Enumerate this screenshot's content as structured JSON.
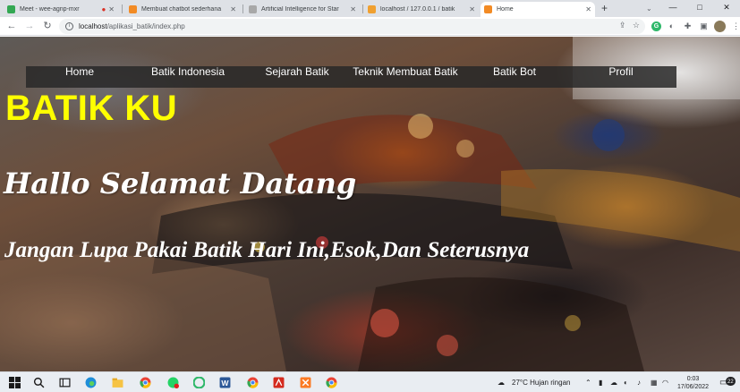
{
  "browser": {
    "tabs": [
      {
        "title": "Meet - wee-agnp-mxr",
        "favicon_color": "#34a853",
        "active": false
      },
      {
        "title": "Membuat chatbot sederhana",
        "favicon_color": "#f28b25",
        "active": false
      },
      {
        "title": "Artificial Intelligence for Star",
        "favicon_color": "#a8a8a8",
        "active": false
      },
      {
        "title": "localhost / 127.0.0.1 / batik",
        "favicon_color": "#f0a030",
        "active": false
      },
      {
        "title": "Home",
        "favicon_color": "#f28b25",
        "active": true
      }
    ],
    "new_tab_glyph": "+",
    "url_host": "localhost",
    "url_path": "/aplikasi_batik/index.php",
    "window_controls": [
      "—",
      "□",
      "✕"
    ]
  },
  "page": {
    "nav": [
      {
        "label": "Home"
      },
      {
        "label": "Batik Indonesia"
      },
      {
        "label": "Sejarah Batik"
      },
      {
        "label": "Teknik Membuat Batik"
      },
      {
        "label": "Batik Bot"
      },
      {
        "label": "Profil"
      }
    ],
    "brand": "BATIK KU",
    "greeting": "Hallo Selamat Datang",
    "tagline": "Jangan Lupa Pakai Batik Hari Ini,Esok,Dan Seterusnya",
    "colors": {
      "brand": "#ffff00",
      "text": "#ffffff",
      "navbar": "#282828"
    }
  },
  "taskbar": {
    "weather": "27°C  Hujan ringan",
    "time": "0:03",
    "date": "17/06/2022",
    "notification_count": "22",
    "icons": [
      "windows-icon",
      "search-icon",
      "task-view-icon",
      "edge-icon",
      "file-explorer-icon",
      "chrome-icon",
      "whatsapp-icon",
      "chrome-canary-icon",
      "word-icon",
      "chrome-icon",
      "acrobat-icon",
      "xampp-icon",
      "chrome-icon"
    ]
  }
}
